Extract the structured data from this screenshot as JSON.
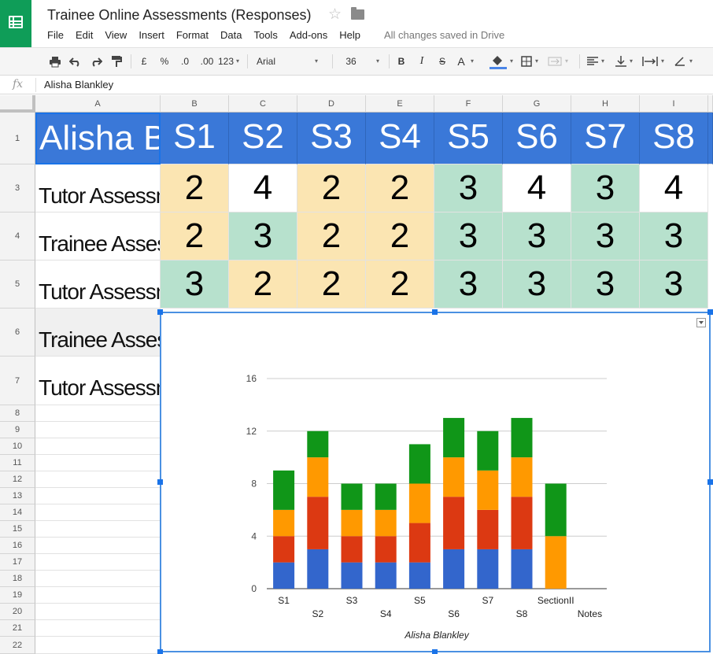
{
  "app": {
    "title": "Trainee Online Assessments (Responses)",
    "menu": [
      "File",
      "Edit",
      "View",
      "Insert",
      "Format",
      "Data",
      "Tools",
      "Add-ons",
      "Help"
    ],
    "save_status": "All changes saved in Drive",
    "brand_color": "#0f9d58"
  },
  "toolbar": {
    "currency": "£",
    "percent": "%",
    "dec_less": ".0",
    "dec_more": ".00",
    "more_formats": "123",
    "font": "Arial",
    "font_size": "36",
    "bold": "B",
    "italic": "I",
    "strike": "S",
    "text_color": "A"
  },
  "formula_bar": {
    "fx": "fx",
    "value": "Alisha Blankley"
  },
  "columns": [
    "A",
    "B",
    "C",
    "D",
    "E",
    "F",
    "G",
    "H",
    "I"
  ],
  "rows": [
    "1",
    "3",
    "4",
    "5",
    "6",
    "7",
    "8",
    "9",
    "10",
    "11",
    "12",
    "13",
    "14",
    "15",
    "16",
    "17",
    "18",
    "19",
    "20",
    "21",
    "22"
  ],
  "sheet": {
    "header": [
      "Alisha Blankley",
      "S1",
      "S2",
      "S3",
      "S4",
      "S5",
      "S6",
      "S7",
      "S8"
    ],
    "labels": [
      "Tutor Assessment",
      "Trainee Assessment",
      "Tutor Assessment",
      "Trainee Assessment",
      "Tutor Assessment"
    ],
    "values": [
      [
        "2",
        "4",
        "2",
        "2",
        "3",
        "4",
        "3",
        "4"
      ],
      [
        "2",
        "3",
        "2",
        "2",
        "3",
        "3",
        "3",
        "3"
      ],
      [
        "3",
        "2",
        "2",
        "2",
        "3",
        "3",
        "3",
        "3"
      ]
    ],
    "fills": [
      [
        "yel",
        "wht",
        "yel",
        "yel",
        "grn",
        "wht",
        "grn",
        "wht"
      ],
      [
        "yel",
        "grn",
        "yel",
        "yel",
        "grn",
        "grn",
        "grn",
        "grn"
      ],
      [
        "grn",
        "yel",
        "yel",
        "yel",
        "grn",
        "grn",
        "grn",
        "grn"
      ]
    ],
    "header_color": "#3a78d8",
    "fill_colors": {
      "yel": "#fbe5b2",
      "grn": "#b7e1cd",
      "wht": "#ffffff"
    }
  },
  "chart_data": {
    "type": "bar",
    "stacked": true,
    "categories": [
      "S1",
      "S2",
      "S3",
      "S4",
      "S5",
      "S6",
      "S7",
      "S8",
      "SectionII",
      "Notes"
    ],
    "series": [
      {
        "color": "#3366cc",
        "values": [
          2,
          3,
          2,
          2,
          2,
          3,
          3,
          3,
          0,
          0
        ]
      },
      {
        "color": "#dc3912",
        "values": [
          2,
          4,
          2,
          2,
          3,
          4,
          3,
          4,
          0,
          0
        ]
      },
      {
        "color": "#ff9900",
        "values": [
          2,
          3,
          2,
          2,
          3,
          3,
          3,
          3,
          4,
          0
        ]
      },
      {
        "color": "#109618",
        "values": [
          3,
          2,
          2,
          2,
          3,
          3,
          3,
          3,
          4,
          0
        ]
      }
    ],
    "yticks": [
      "0",
      "4",
      "8",
      "12",
      "16"
    ],
    "ylim": [
      0,
      16
    ],
    "xlabel": "Alisha Blankley",
    "ylabel": "",
    "grid": true,
    "legend": "none"
  }
}
